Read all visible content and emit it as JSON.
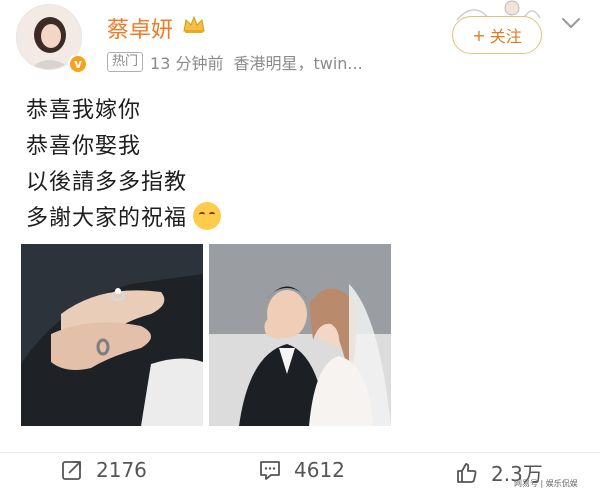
{
  "profile": {
    "name": "蔡卓妍",
    "verified_color": "#f7a21b",
    "name_color": "#f07a26"
  },
  "meta": {
    "tag": "热门",
    "time": "13 分钟前",
    "source": "香港明星，twin..."
  },
  "follow": {
    "label": "关注",
    "plus": "+"
  },
  "post": {
    "lines": [
      "恭喜我嫁你",
      "恭喜你娶我",
      "以後請多多指教",
      "多謝大家的祝福"
    ],
    "emoji": "smiling-face-with-hearts"
  },
  "actions": {
    "repost_count": "2176",
    "comment_count": "4612",
    "like_count": "2.3万"
  },
  "watermark": {
    "text": "网易号 | 娱乐侃娱"
  }
}
